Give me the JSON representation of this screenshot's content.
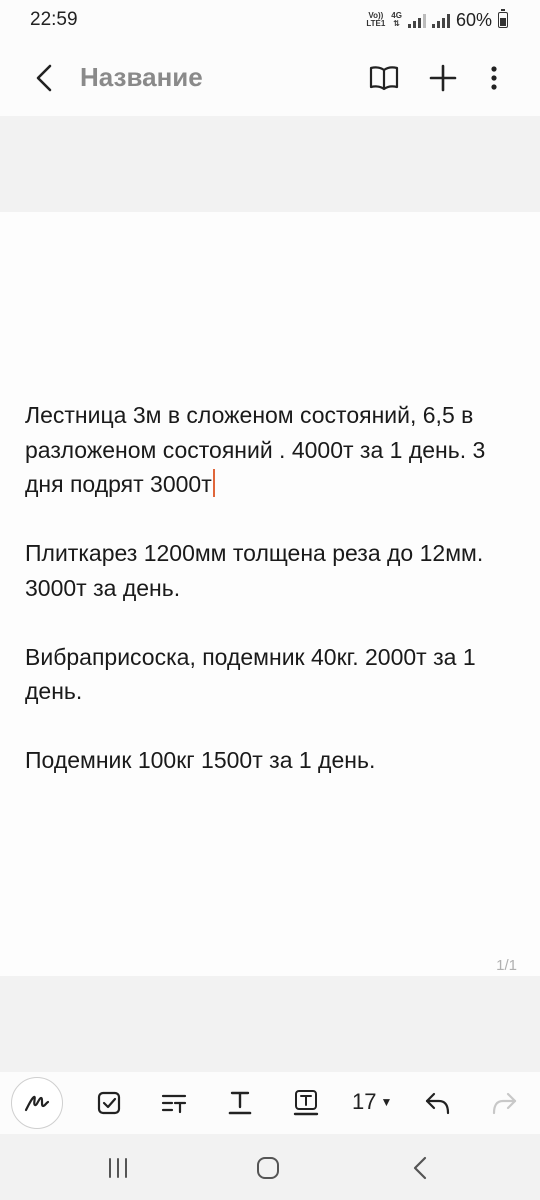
{
  "status_bar": {
    "time": "22:59",
    "net_top": "Vo))",
    "net_bottom": "LTE1",
    "net_type": "4G",
    "battery": "60%"
  },
  "header": {
    "title": "Название",
    "icons": [
      "back-icon",
      "book-icon",
      "plus-icon",
      "more-icon"
    ]
  },
  "note": {
    "paragraphs": [
      "Лестница 3м в сложеном состояний, 6,5 в разложеном состояний . 4000т за 1 день. 3 дня подрят 3000т",
      "Плиткарез 1200мм толщена реза до 12мм. 3000т за день.",
      "Вибраприсоска, подемник 40кг. 2000т за 1 день.",
      "Подемник 100кг 1500т за 1 день."
    ],
    "page_indicator": "1/1"
  },
  "toolbar": {
    "font_size": "17",
    "tools": [
      "pen-icon",
      "checkbox-icon",
      "text-style-icon",
      "text-color-icon",
      "text-box-icon",
      "font-size-dropdown",
      "undo-icon",
      "redo-icon"
    ]
  },
  "nav": {
    "icons": [
      "recents-icon",
      "home-icon",
      "back-nav-icon"
    ]
  },
  "colors": {
    "cursor": "#e0663a",
    "title": "#8a8a8a",
    "background": "#f2f2f2",
    "page": "#fdfdfd"
  }
}
